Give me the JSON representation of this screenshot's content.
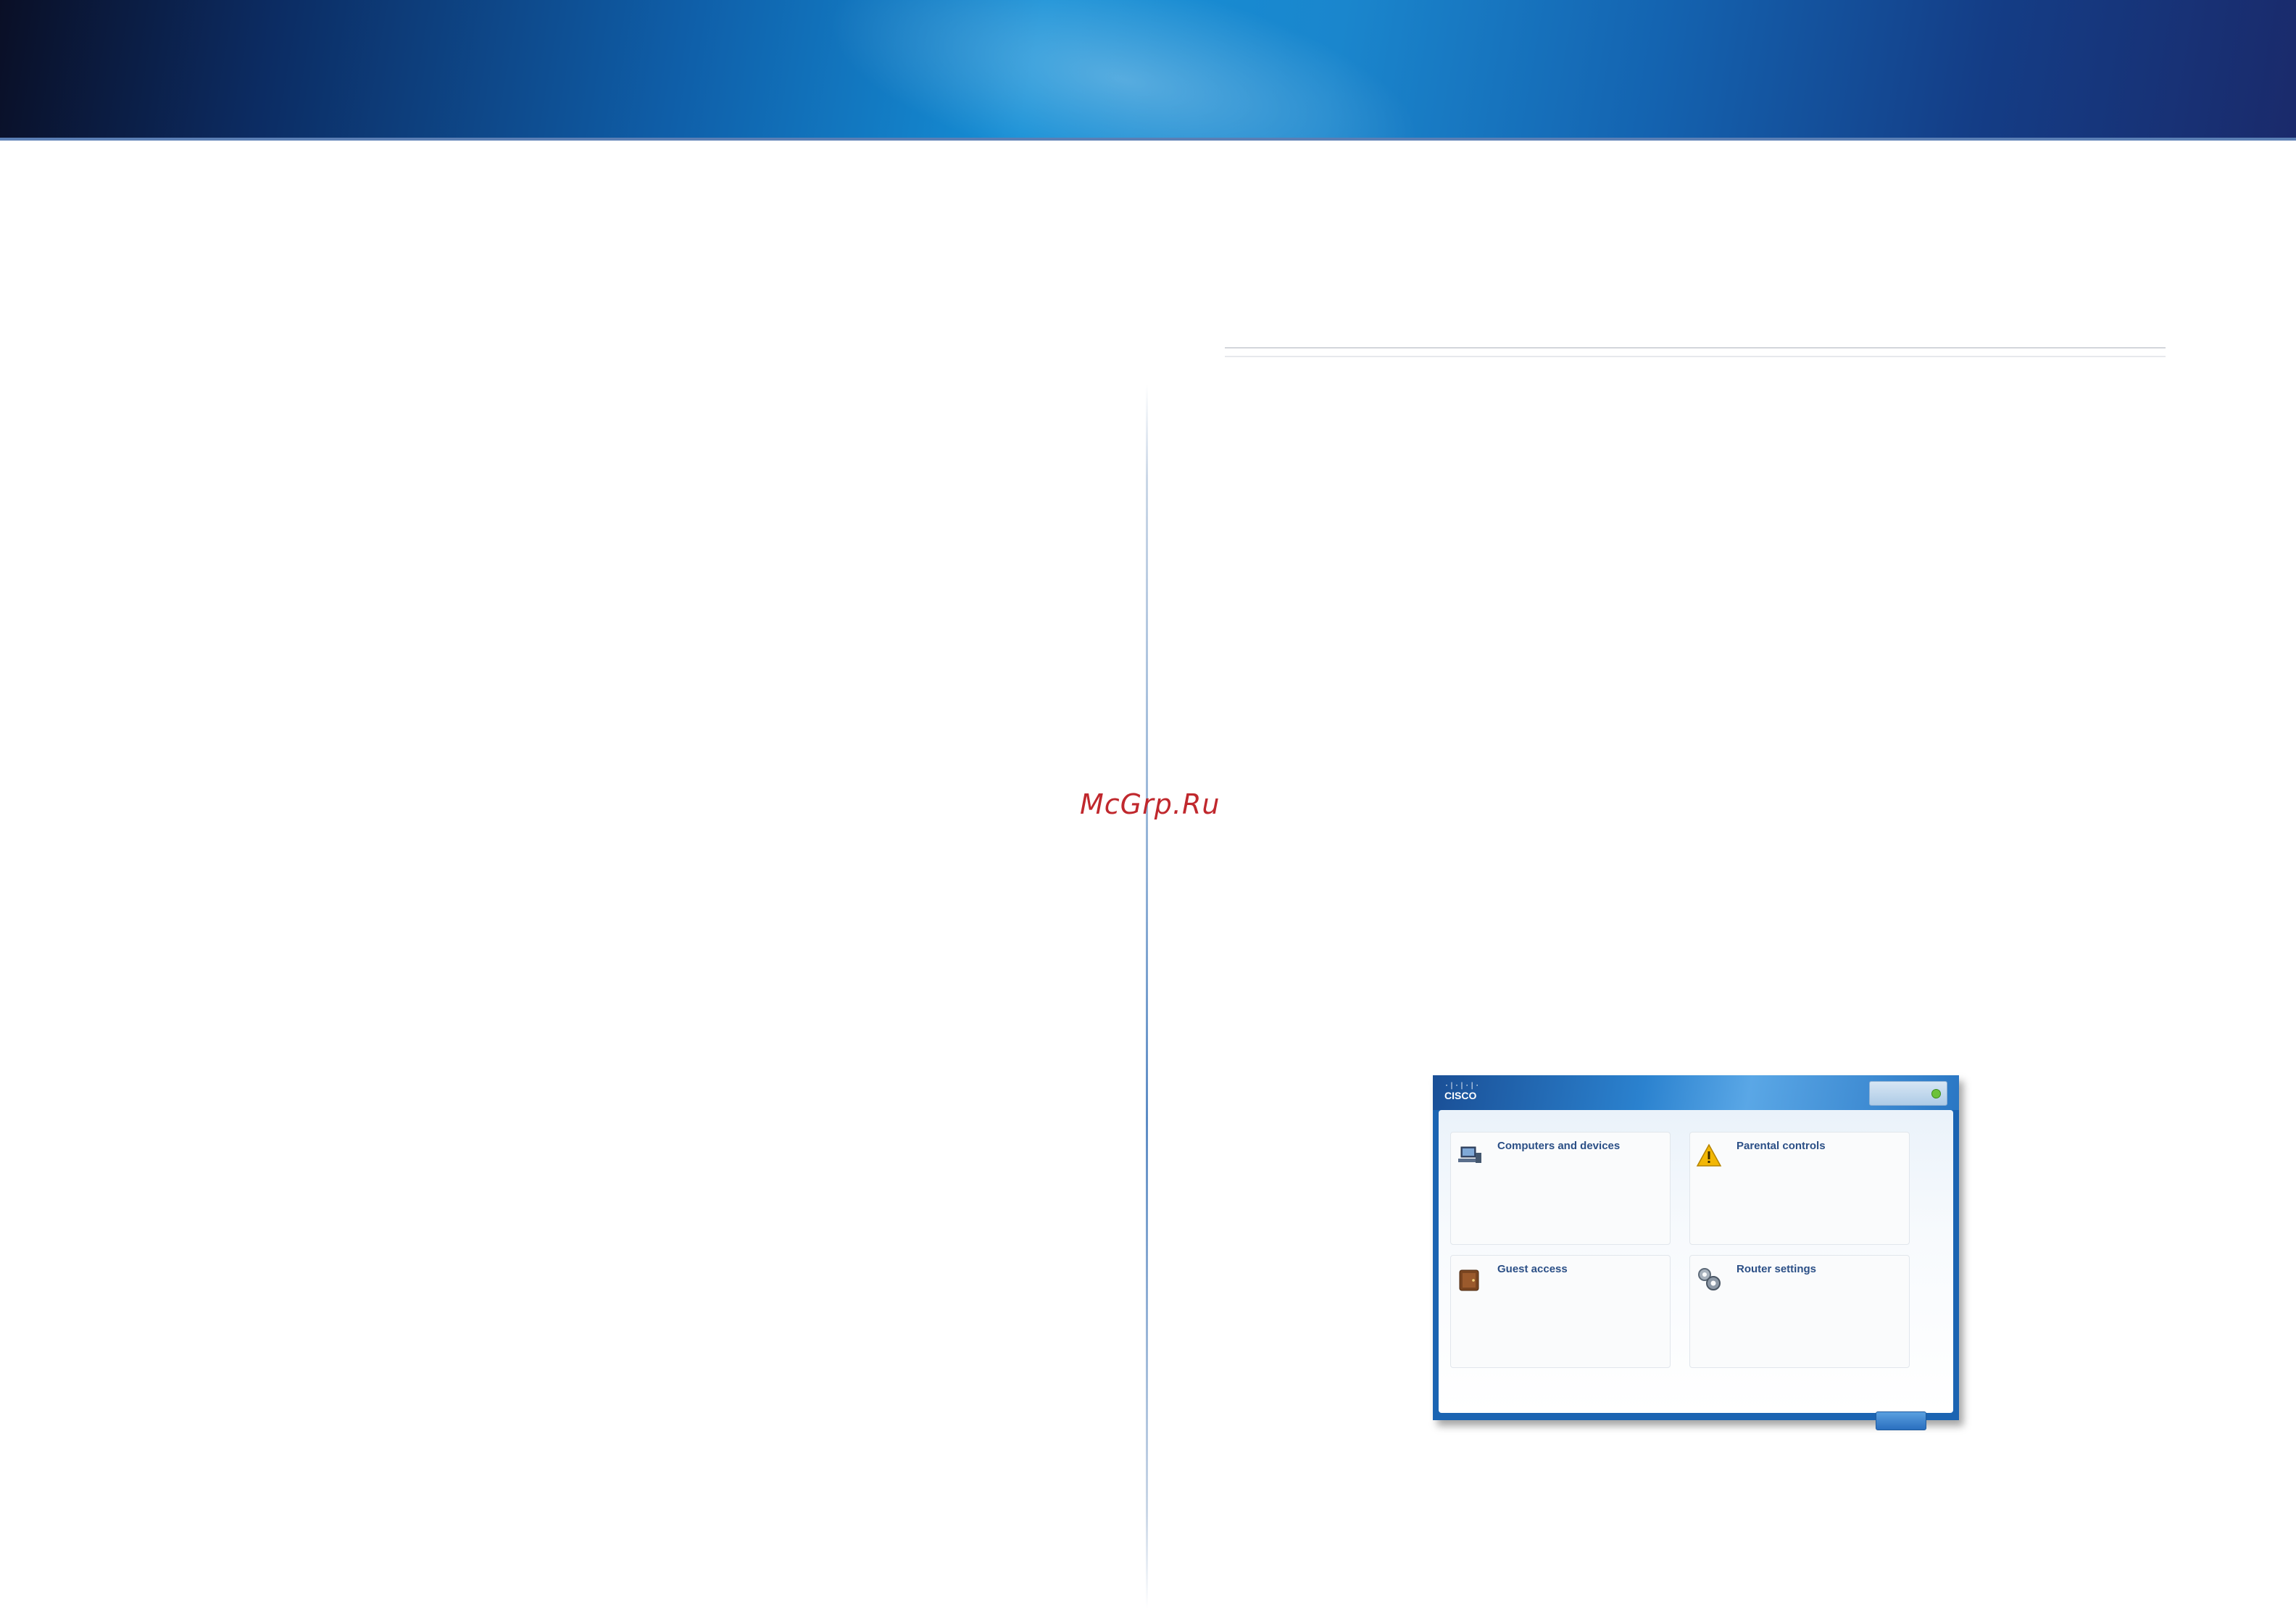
{
  "watermark": "McGrp.Ru",
  "app": {
    "logo_bars": "·|·|·|·",
    "logo_text": "CISCO",
    "status_text": "",
    "cards": [
      {
        "title": "Computers and devices",
        "description": "",
        "note": "",
        "link": ""
      },
      {
        "title": "Parental controls",
        "description": "",
        "note": "",
        "link": ""
      },
      {
        "title": "Guest access",
        "description": "",
        "note": "",
        "link": ""
      },
      {
        "title": "Router settings",
        "description": "",
        "note": "",
        "link": ""
      }
    ],
    "close_label": ""
  },
  "colors": {
    "accent": "#2b4f86",
    "link": "#3a82d0",
    "status_ok": "#6cc23a",
    "watermark": "#c0282d"
  },
  "icons": [
    "computer-icon",
    "warning-icon",
    "guest-icon",
    "gears-icon"
  ]
}
